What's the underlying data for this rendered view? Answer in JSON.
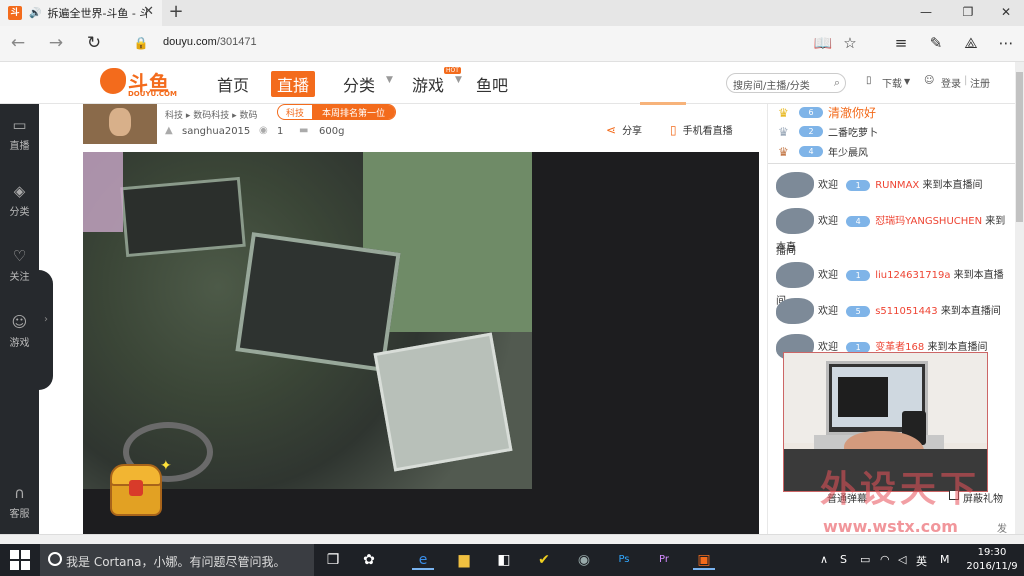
{
  "browser": {
    "tab_title": "拆遍全世界-斗鱼 - 斗",
    "favicon_text": "斗",
    "url_domain": "douyu.com",
    "url_path": "/301471"
  },
  "site": {
    "logo_text": "斗鱼",
    "logo_sub": "DOUYU.COM",
    "nav": [
      "首页",
      "直播",
      "分类",
      "游戏",
      "鱼吧"
    ],
    "hot_badge": "HOT",
    "search_placeholder": "搜房间/主播/分类",
    "download": "下载",
    "login": "登录",
    "register": "注册"
  },
  "leftbar": {
    "items": [
      {
        "label": "直播",
        "icon": "tv-icon"
      },
      {
        "label": "分类",
        "icon": "layers-icon"
      },
      {
        "label": "关注",
        "icon": "heart-icon"
      },
      {
        "label": "游戏",
        "icon": "gamepad-icon"
      },
      {
        "label": "客服",
        "icon": "headset-icon"
      }
    ]
  },
  "room": {
    "breadcrumb": [
      "科技",
      "数码科技",
      "数码"
    ],
    "rank_tag": "科技",
    "rank_text": "本周排名第一位",
    "anchor": "sanghua2015",
    "level": "1",
    "weight": "600g",
    "share": "分享",
    "mobile_watch": "手机看直播"
  },
  "fans": [
    {
      "badge": "6",
      "name": "清澈你好"
    },
    {
      "badge": "2",
      "name": "二番吃萝卜"
    },
    {
      "badge": "4",
      "name": "年少晨风"
    }
  ],
  "chat": {
    "welcome": "欢迎",
    "suffix": "来到本直播间",
    "messages": [
      {
        "badge": "1",
        "user": "RUNMAX",
        "tail": "来到本直播间"
      },
      {
        "badge": "4",
        "user": "怼瑞玛YANGSHUCHEN",
        "tail": "来到本直",
        "wrap": "播间"
      },
      {
        "badge": "1",
        "user": "liu124631719a",
        "tail": "来到本直播间"
      },
      {
        "badge": "5",
        "user": "s511051443",
        "tail": "来到本直播间"
      },
      {
        "badge": "1",
        "user": "变革者168",
        "tail": "来到本直播间"
      }
    ],
    "normal_danmu": "普通弹幕",
    "block_gift": "屏蔽礼物",
    "send": "发"
  },
  "watermark": {
    "big": "外设天下",
    "url": "www.wstx.com"
  },
  "taskbar": {
    "cortana": "我是 Cortana，小娜。有问题尽管问我。",
    "ime": "英",
    "time": "19:30",
    "date": "2016/11/9"
  },
  "colors": {
    "brand": "#f36b1c",
    "taskbar": "#1e2126",
    "leftbar": "#26292d"
  }
}
